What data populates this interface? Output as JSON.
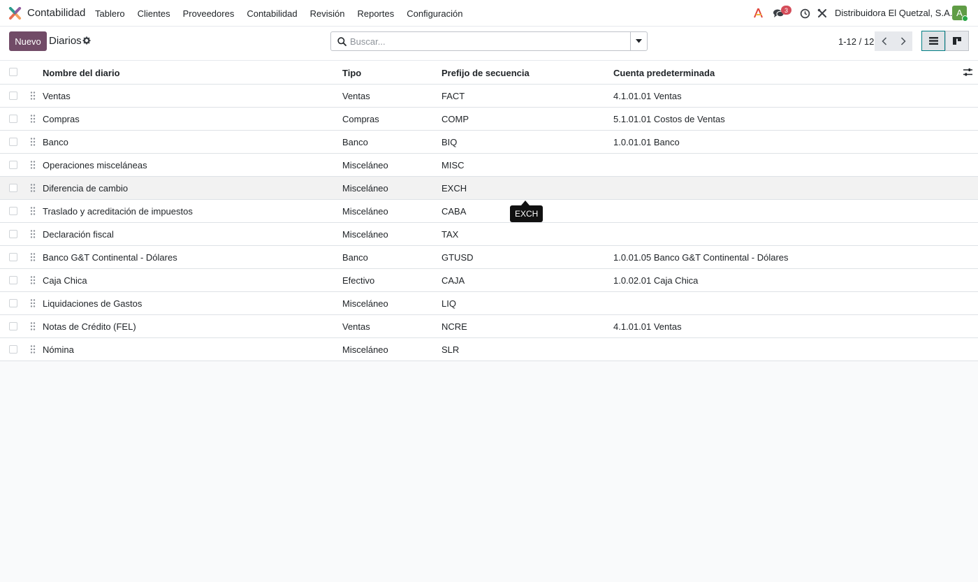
{
  "navbar": {
    "app_name": "Contabilidad",
    "menu": [
      "Tablero",
      "Clientes",
      "Proveedores",
      "Contabilidad",
      "Revisión",
      "Reportes",
      "Configuración"
    ],
    "message_count": "3",
    "company": "Distribuidora El Quetzal, S.A.",
    "avatar_initial": "A",
    "avatar_color": "#5f9c45",
    "brand_color": "#714b67"
  },
  "control_panel": {
    "new_button": "Nuevo",
    "title": "Diarios",
    "search_placeholder": "Buscar...",
    "pager": "1-12 / 12"
  },
  "table": {
    "headers": {
      "name": "Nombre del diario",
      "type": "Tipo",
      "prefix": "Prefijo de secuencia",
      "account": "Cuenta predeterminada"
    },
    "rows": [
      {
        "name": "Ventas",
        "type": "Ventas",
        "prefix": "FACT",
        "account": "4.1.01.01 Ventas"
      },
      {
        "name": "Compras",
        "type": "Compras",
        "prefix": "COMP",
        "account": "5.1.01.01 Costos de Ventas"
      },
      {
        "name": "Banco",
        "type": "Banco",
        "prefix": "BIQ",
        "account": "1.0.01.01 Banco"
      },
      {
        "name": "Operaciones misceláneas",
        "type": "Misceláneo",
        "prefix": "MISC",
        "account": ""
      },
      {
        "name": "Diferencia de cambio",
        "type": "Misceláneo",
        "prefix": "EXCH",
        "account": ""
      },
      {
        "name": "Traslado y acreditación de impuestos",
        "type": "Misceláneo",
        "prefix": "CABA",
        "account": ""
      },
      {
        "name": "Declaración fiscal",
        "type": "Misceláneo",
        "prefix": "TAX",
        "account": ""
      },
      {
        "name": "Banco G&T Continental - Dólares",
        "type": "Banco",
        "prefix": "GTUSD",
        "account": "1.0.01.05 Banco G&T Continental - Dólares"
      },
      {
        "name": "Caja Chica",
        "type": "Efectivo",
        "prefix": "CAJA",
        "account": "1.0.02.01 Caja Chica"
      },
      {
        "name": "Liquidaciones de Gastos",
        "type": "Misceláneo",
        "prefix": "LIQ",
        "account": ""
      },
      {
        "name": "Notas de Crédito (FEL)",
        "type": "Ventas",
        "prefix": "NCRE",
        "account": "4.1.01.01 Ventas"
      },
      {
        "name": "Nómina",
        "type": "Misceláneo",
        "prefix": "SLR",
        "account": ""
      }
    ]
  },
  "tooltip": {
    "text": "EXCH"
  }
}
